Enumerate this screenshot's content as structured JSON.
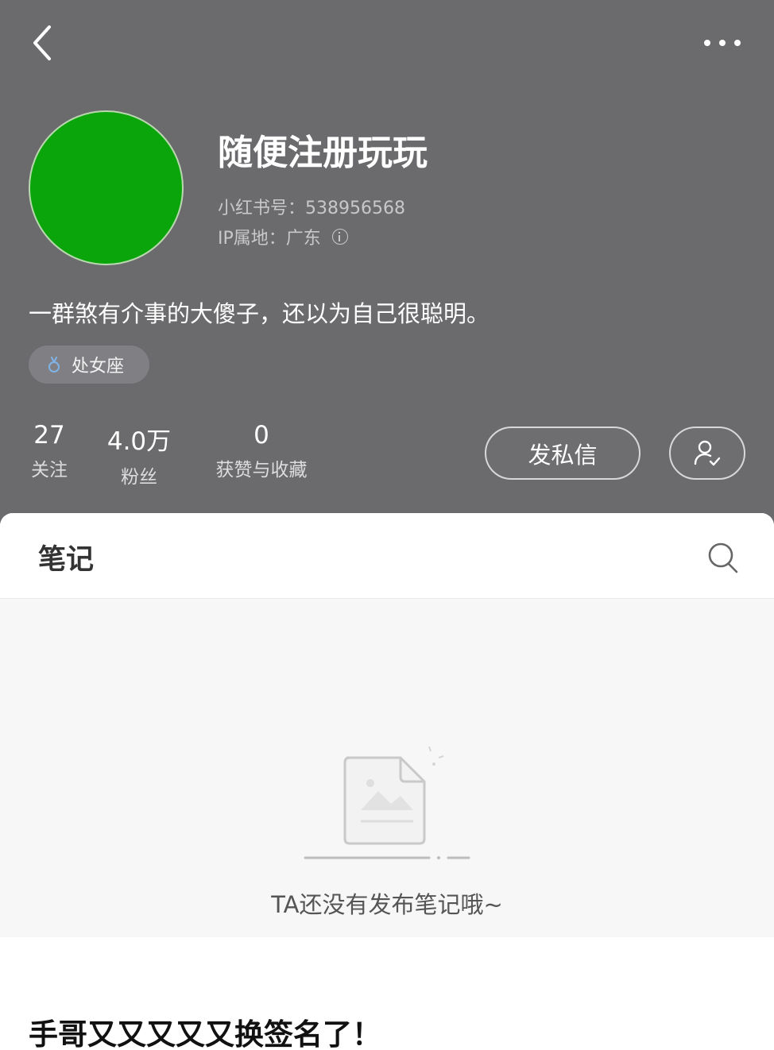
{
  "topbar": {
    "back_icon": "chevron-left-icon",
    "more_icon": "more-dots-icon"
  },
  "profile": {
    "avatar_color": "#0aa50a",
    "nickname": "随便注册玩玩",
    "id_line": "小红书号：538956568",
    "ip_line": "IP属地：广东",
    "bio": "一群煞有介事的大傻子，还以为自己很聪明。",
    "tag": {
      "icon": "virgo-icon",
      "label": "处女座"
    }
  },
  "stats": [
    {
      "value": "27",
      "label": "关注"
    },
    {
      "value": "4.0万",
      "label": "粉丝"
    },
    {
      "value": "0",
      "label": "获赞与收藏"
    }
  ],
  "actions": {
    "message_label": "发私信",
    "follow_icon": "user-check-icon"
  },
  "notes": {
    "tab_label": "笔记",
    "search_icon": "search-icon",
    "empty_text": "TA还没有发布笔记哦~"
  },
  "caption": "手哥又又又又又换签名了！",
  "colors": {
    "header_bg": "#6b6b6e",
    "panel_bg": "#f7f7f7",
    "text_primary": "#ffffff"
  }
}
